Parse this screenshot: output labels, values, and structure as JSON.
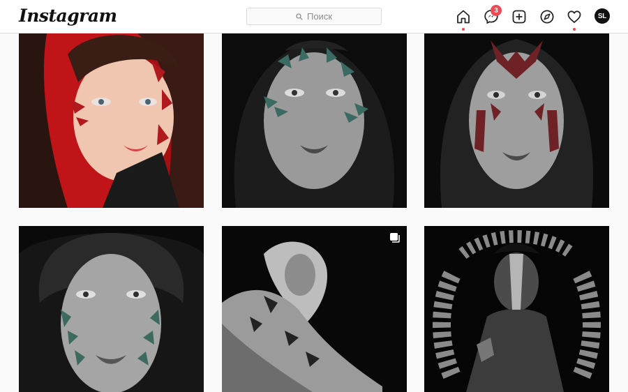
{
  "header": {
    "logo": "Instagram",
    "search_placeholder": "Поиск",
    "messages_badge": "3",
    "avatar_initials": "SL"
  },
  "icons": {
    "home": "home-icon",
    "messages": "messenger-icon",
    "new_post": "plus-square-icon",
    "explore": "compass-icon",
    "activity": "heart-icon"
  },
  "colors": {
    "accent_red": "#ed4956",
    "border": "#dbdbdb",
    "background": "#fafafa"
  },
  "posts": [
    {
      "label": "portrait-red-background-calligraphy",
      "multiple": false
    },
    {
      "label": "portrait-bw-green-calligraphy",
      "multiple": false
    },
    {
      "label": "portrait-bw-red-calligraphy",
      "multiple": false
    },
    {
      "label": "portrait-curly-hair-green-calligraphy",
      "multiple": false
    },
    {
      "label": "portrait-blonde-body-calligraphy",
      "multiple": true
    },
    {
      "label": "portrait-dark-calligraphy-ring",
      "multiple": false
    }
  ]
}
